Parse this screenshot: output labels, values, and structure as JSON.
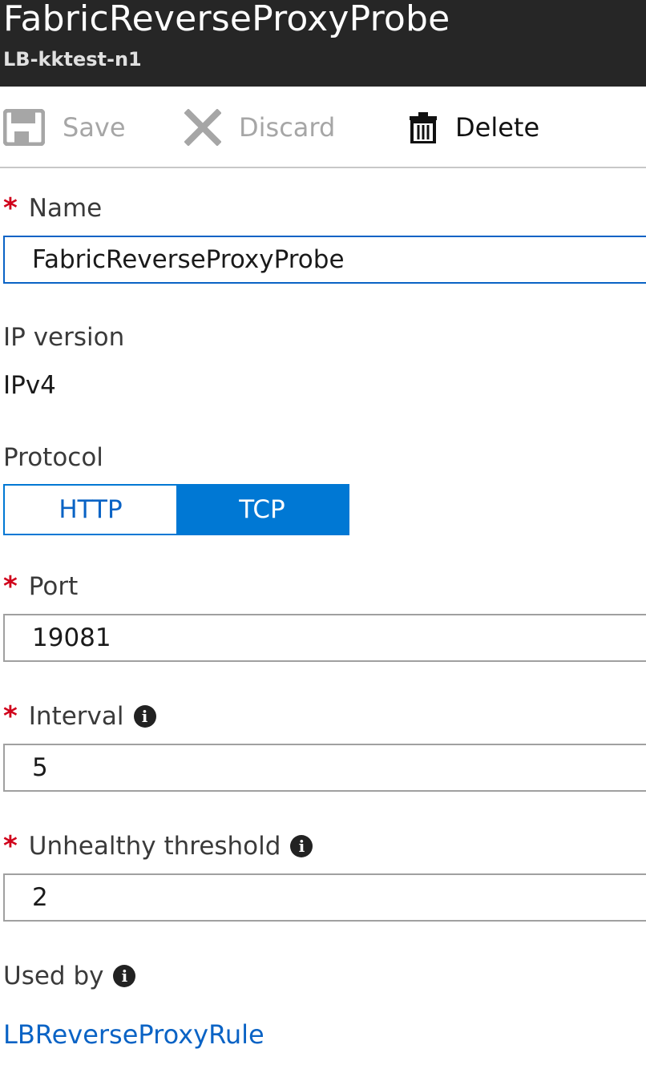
{
  "header": {
    "title": "FabricReverseProxyProbe",
    "subtitle": "LB-kktest-n1"
  },
  "toolbar": {
    "save_label": "Save",
    "discard_label": "Discard",
    "delete_label": "Delete"
  },
  "form": {
    "required_marker": "*",
    "name": {
      "label": "Name",
      "value": "FabricReverseProxyProbe"
    },
    "ip_version": {
      "label": "IP version",
      "value": "IPv4"
    },
    "protocol": {
      "label": "Protocol",
      "options": [
        "HTTP",
        "TCP"
      ],
      "selected": "TCP"
    },
    "port": {
      "label": "Port",
      "value": "19081"
    },
    "interval": {
      "label": "Interval",
      "value": "5"
    },
    "unhealthy_threshold": {
      "label": "Unhealthy threshold",
      "value": "2"
    },
    "used_by": {
      "label": "Used by",
      "link": "LBReverseProxyRule"
    },
    "info_glyph": "i"
  },
  "colors": {
    "header_bg": "#262626",
    "accent": "#0078d4",
    "link": "#0a63c5",
    "required": "#d0021b"
  }
}
